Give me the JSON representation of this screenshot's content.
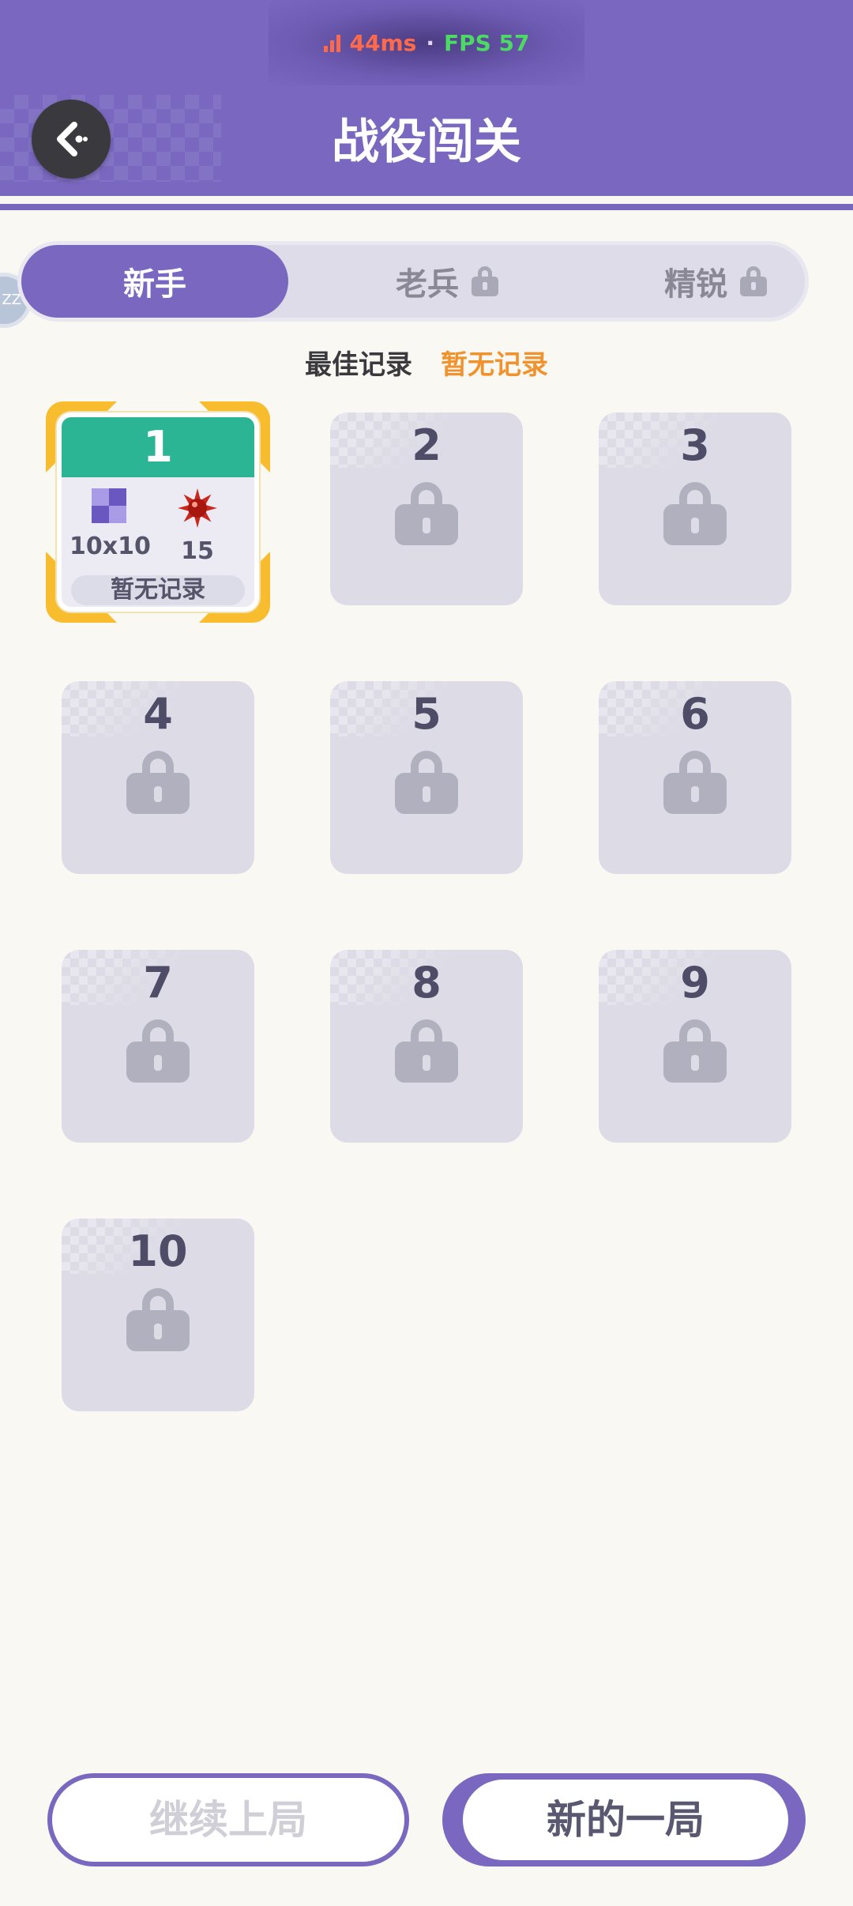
{
  "status": {
    "latency": "44ms",
    "separator": "·",
    "fps": "FPS 57"
  },
  "header": {
    "title": "战役闯关"
  },
  "side_badge": {
    "text": "ZZ"
  },
  "tabs": [
    {
      "label": "新手",
      "active": true,
      "locked": false
    },
    {
      "label": "老兵",
      "active": false,
      "locked": true
    },
    {
      "label": "精锐",
      "active": false,
      "locked": true
    }
  ],
  "best_record": {
    "label": "最佳记录",
    "value": "暂无记录"
  },
  "levels": [
    {
      "number": "1",
      "unlocked": true,
      "size": "10x10",
      "mines": "15",
      "record": "暂无记录"
    },
    {
      "number": "2",
      "unlocked": false
    },
    {
      "number": "3",
      "unlocked": false
    },
    {
      "number": "4",
      "unlocked": false
    },
    {
      "number": "5",
      "unlocked": false
    },
    {
      "number": "6",
      "unlocked": false
    },
    {
      "number": "7",
      "unlocked": false
    },
    {
      "number": "8",
      "unlocked": false
    },
    {
      "number": "9",
      "unlocked": false
    },
    {
      "number": "10",
      "unlocked": false
    }
  ],
  "buttons": {
    "continue": "继续上局",
    "new_game": "新的一局"
  },
  "colors": {
    "primary": "#7a68c0",
    "level_header": "#2bb595",
    "highlight": "#f7bd2e",
    "record": "#f0922e",
    "latency": "#ff6b4a",
    "fps": "#4cd964"
  },
  "icons": {
    "back": "back-arrow-icon",
    "signal": "signal-bars-icon",
    "lock": "lock-icon",
    "grid": "grid-size-icon",
    "mine": "mine-icon"
  }
}
